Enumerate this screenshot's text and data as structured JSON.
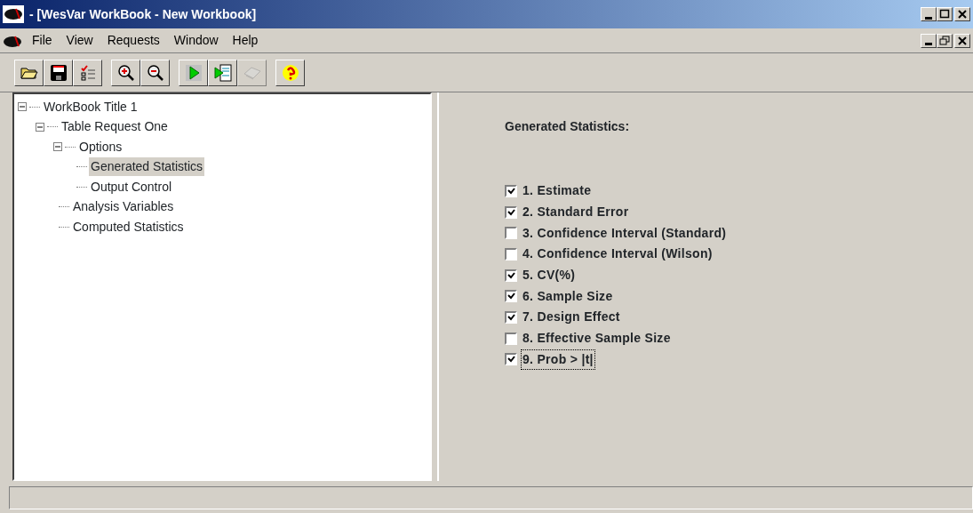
{
  "window": {
    "title": "- [WesVar WorkBook - New Workbook]"
  },
  "menu": [
    "File",
    "View",
    "Requests",
    "Window",
    "Help"
  ],
  "toolbar": {
    "groups": [
      [
        {
          "disabled": false
        },
        {
          "disabled": false
        },
        {
          "disabled": false
        }
      ],
      [
        {
          "disabled": false
        },
        {
          "disabled": false
        }
      ],
      [
        {
          "disabled": false
        },
        {
          "disabled": false
        },
        {
          "disabled": true
        }
      ],
      [
        {
          "disabled": false
        }
      ]
    ]
  },
  "tree": [
    {
      "label": "WorkBook Title 1",
      "selected": false,
      "expanded": true,
      "children": [
        {
          "label": "Table Request One",
          "selected": false,
          "expanded": true,
          "children": [
            {
              "label": "Options",
              "selected": false,
              "expanded": true,
              "children": [
                {
                  "label": "Generated Statistics",
                  "selected": true
                },
                {
                  "label": "Output Control",
                  "selected": false
                }
              ]
            },
            {
              "label": "Analysis Variables",
              "selected": false
            },
            {
              "label": "Computed Statistics",
              "selected": false
            }
          ]
        }
      ]
    }
  ],
  "panel": {
    "heading": "Generated Statistics:",
    "options": [
      {
        "label": "1. Estimate",
        "checked": true,
        "focused": false
      },
      {
        "label": "2. Standard Error",
        "checked": true,
        "focused": false
      },
      {
        "label": "3. Confidence Interval (Standard)",
        "checked": false,
        "focused": false
      },
      {
        "label": "4. Confidence Interval (Wilson)",
        "checked": false,
        "focused": false
      },
      {
        "label": "5. CV(%)",
        "checked": true,
        "focused": false
      },
      {
        "label": "6. Sample Size",
        "checked": true,
        "focused": false
      },
      {
        "label": "7. Design Effect",
        "checked": true,
        "focused": false
      },
      {
        "label": "8. Effective Sample Size",
        "checked": false,
        "focused": false
      },
      {
        "label": "9. Prob > |t|",
        "checked": true,
        "focused": true
      }
    ]
  }
}
